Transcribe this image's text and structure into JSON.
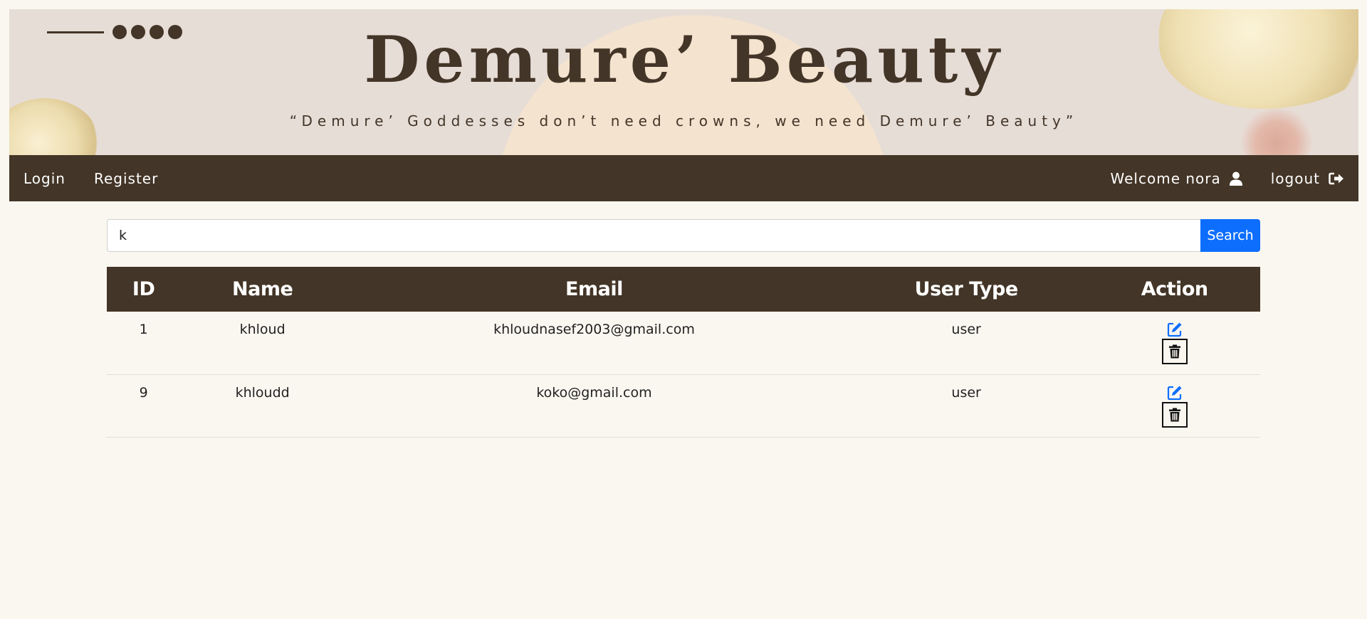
{
  "brand": {
    "title": "Demure’ Beauty",
    "tagline": "“Demure’ Goddesses don’t need crowns, we need Demure’ Beauty”"
  },
  "nav": {
    "login": "Login",
    "register": "Register",
    "welcome": "Welcome nora",
    "logout": "logout"
  },
  "search": {
    "value": "k",
    "button": "Search"
  },
  "table": {
    "headers": {
      "id": "ID",
      "name": "Name",
      "email": "Email",
      "user_type": "User Type",
      "action": "Action"
    },
    "rows": [
      {
        "id": "1",
        "name": "khloud",
        "email": "khloudnasef2003@gmail.com",
        "user_type": "user"
      },
      {
        "id": "9",
        "name": "khloudd",
        "email": "koko@gmail.com",
        "user_type": "user"
      }
    ]
  },
  "colors": {
    "brand_brown": "#433527",
    "banner_bg": "#e7ddd7",
    "page_bg": "#faf7f0",
    "accent_blue": "#0d6efd"
  },
  "icons": {
    "user": "user-icon",
    "logout": "logout-icon",
    "edit": "edit-icon",
    "delete": "trash-icon"
  }
}
